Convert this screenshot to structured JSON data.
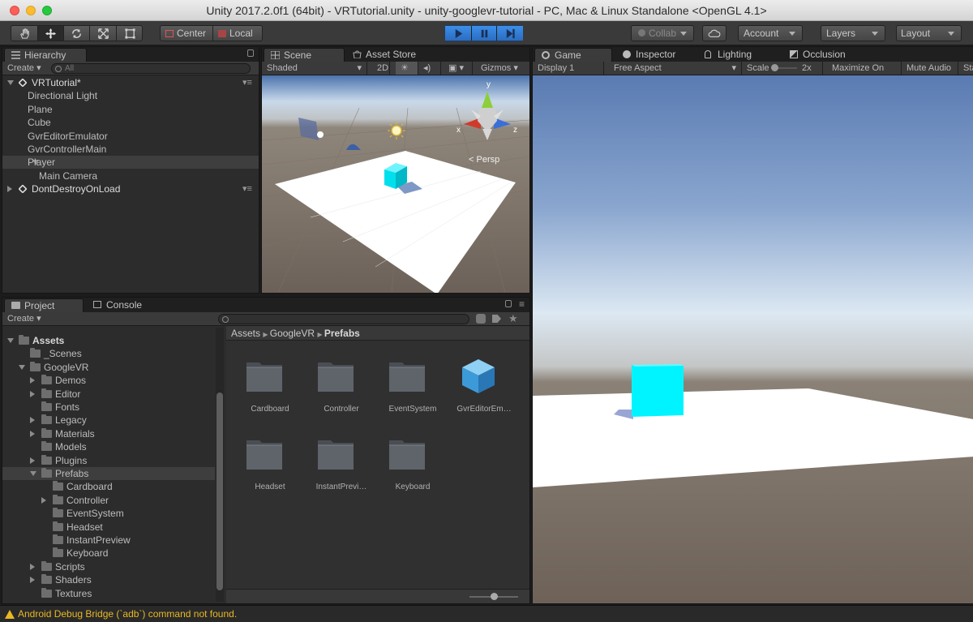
{
  "window": {
    "title": "Unity 2017.2.0f1 (64bit) - VRTutorial.unity - unity-googlevr-tutorial - PC, Mac & Linux Standalone <OpenGL 4.1>"
  },
  "toolbar": {
    "pivot_center": "Center",
    "pivot_local": "Local",
    "collab": "Collab",
    "account": "Account",
    "layers": "Layers",
    "layout": "Layout",
    "play_state": "playing"
  },
  "hierarchy": {
    "tab": "Hierarchy",
    "create": "Create",
    "search_placeholder": "All",
    "items": [
      {
        "label": "VRTutorial*",
        "depth": 0,
        "expand": "open",
        "scene": true
      },
      {
        "label": "Directional Light",
        "depth": 1
      },
      {
        "label": "Plane",
        "depth": 1
      },
      {
        "label": "Cube",
        "depth": 1
      },
      {
        "label": "GvrEditorEmulator",
        "depth": 1
      },
      {
        "label": "GvrControllerMain",
        "depth": 1
      },
      {
        "label": "Player",
        "depth": 1,
        "expand": "open",
        "selected": true
      },
      {
        "label": "Main Camera",
        "depth": 2
      },
      {
        "label": "DontDestroyOnLoad",
        "depth": 0,
        "expand": "closed",
        "scene": true
      }
    ]
  },
  "scene": {
    "tab": "Scene",
    "asset_store_tab": "Asset Store",
    "shading": "Shaded",
    "mode_2d": "2D",
    "gizmos": "Gizmos",
    "persp": "Persp",
    "axis_x": "x",
    "axis_y": "y",
    "axis_z": "z"
  },
  "game": {
    "tabs": [
      "Game",
      "Inspector",
      "Lighting",
      "Occlusion"
    ],
    "display": "Display 1",
    "aspect": "Free Aspect",
    "scale_label": "Scale",
    "scale_value": "2x",
    "maximize": "Maximize On Play",
    "mute": "Mute Audio",
    "stats": "Sta"
  },
  "project": {
    "tab": "Project",
    "console_tab": "Console",
    "create": "Create",
    "breadcrumb": [
      "Assets",
      "GoogleVR",
      "Prefabs"
    ],
    "tree": [
      {
        "label": "Assets",
        "depth": 0,
        "expand": "open",
        "bold": true
      },
      {
        "label": "_Scenes",
        "depth": 1
      },
      {
        "label": "GoogleVR",
        "depth": 1,
        "expand": "open"
      },
      {
        "label": "Demos",
        "depth": 2,
        "expand": "closed"
      },
      {
        "label": "Editor",
        "depth": 2,
        "expand": "closed"
      },
      {
        "label": "Fonts",
        "depth": 2
      },
      {
        "label": "Legacy",
        "depth": 2,
        "expand": "closed"
      },
      {
        "label": "Materials",
        "depth": 2,
        "expand": "closed"
      },
      {
        "label": "Models",
        "depth": 2
      },
      {
        "label": "Plugins",
        "depth": 2,
        "expand": "closed"
      },
      {
        "label": "Prefabs",
        "depth": 2,
        "expand": "open",
        "selected": true
      },
      {
        "label": "Cardboard",
        "depth": 3
      },
      {
        "label": "Controller",
        "depth": 3,
        "expand": "closed"
      },
      {
        "label": "EventSystem",
        "depth": 3
      },
      {
        "label": "Headset",
        "depth": 3
      },
      {
        "label": "InstantPreview",
        "depth": 3
      },
      {
        "label": "Keyboard",
        "depth": 3
      },
      {
        "label": "Scripts",
        "depth": 2,
        "expand": "closed"
      },
      {
        "label": "Shaders",
        "depth": 2,
        "expand": "closed"
      },
      {
        "label": "Textures",
        "depth": 2
      }
    ],
    "grid": [
      {
        "label": "Cardboard",
        "kind": "folder"
      },
      {
        "label": "Controller",
        "kind": "folder"
      },
      {
        "label": "EventSystem",
        "kind": "folder"
      },
      {
        "label": "GvrEditorEm…",
        "kind": "prefab"
      },
      {
        "label": "Headset",
        "kind": "folder"
      },
      {
        "label": "InstantPrevi…",
        "kind": "folder"
      },
      {
        "label": "Keyboard",
        "kind": "folder"
      }
    ]
  },
  "status": {
    "message": "Android Debug Bridge (`adb`) command not found."
  },
  "colors": {
    "accent_play": "#3c8fe8",
    "selection": "#3e3e3e",
    "cube": "#00f4ff",
    "warning": "#e8b825"
  }
}
